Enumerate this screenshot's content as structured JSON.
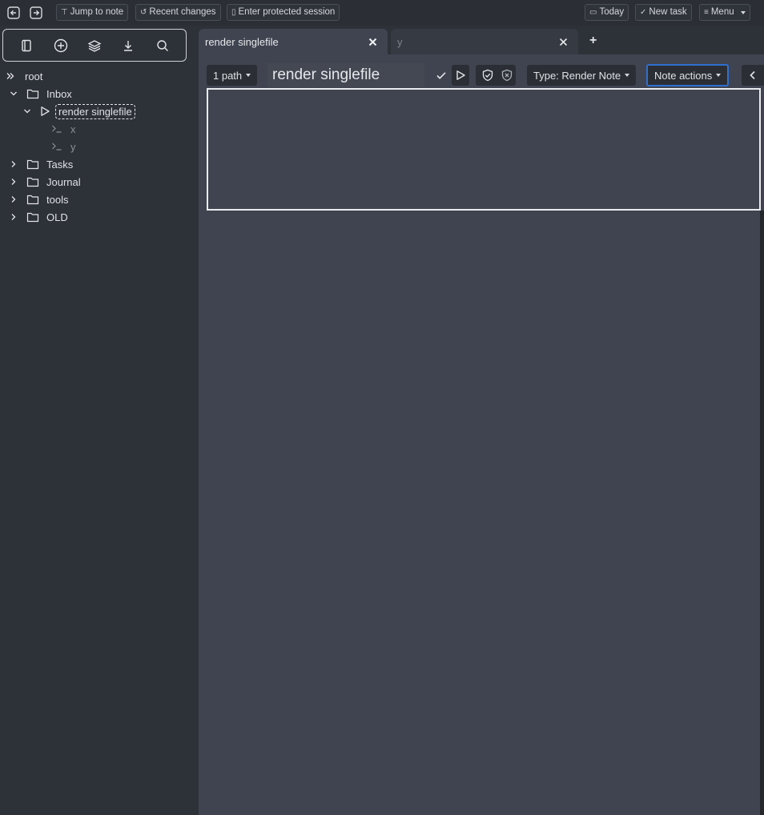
{
  "topbar": {
    "back_icon": "arrow-left-icon",
    "forward_icon": "arrow-right-icon",
    "jump_label": "Jump to note",
    "recent_label": "Recent changes",
    "protected_label": "Enter protected session",
    "today_label": "Today",
    "newtask_label": "New task",
    "menu_label": "Menu"
  },
  "launcher": {
    "icons": [
      "new-note-icon",
      "add-icon",
      "layers-icon",
      "download-icon",
      "search-icon"
    ]
  },
  "tree": {
    "items": [
      {
        "label": "root"
      },
      {
        "label": "Inbox"
      },
      {
        "label": "render singlefile"
      },
      {
        "label": "x"
      },
      {
        "label": "y"
      },
      {
        "label": "Tasks"
      },
      {
        "label": "Journal"
      },
      {
        "label": "tools"
      },
      {
        "label": "OLD"
      }
    ]
  },
  "tabs": [
    {
      "title": "render singlefile"
    },
    {
      "title": "y"
    }
  ],
  "ribbon": {
    "path_label": "1 path",
    "note_title": "render singlefile",
    "type_label": "Type: Render Note",
    "actions_label": "Note actions"
  },
  "colors": {
    "accent": "#2f6fd1",
    "background": "#3f4450",
    "sidebar": "#2d3138",
    "topbar": "#2b2f35"
  }
}
